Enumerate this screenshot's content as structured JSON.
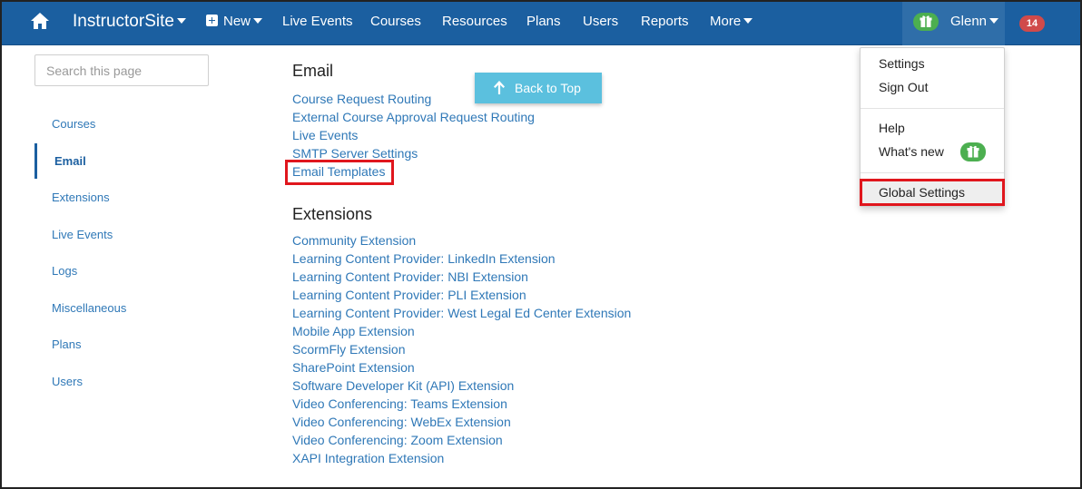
{
  "topnav": {
    "brand": "InstructorSite",
    "new_label": "New",
    "items": [
      "Live Events",
      "Courses",
      "Resources",
      "Plans",
      "Users",
      "Reports"
    ],
    "more_label": "More",
    "user_name": "Glenn",
    "notification_count": "14",
    "colors": {
      "bar": "#1b5fa0",
      "badge": "#d04a4a",
      "gift": "#4caf50"
    }
  },
  "sidebar": {
    "search_placeholder": "Search this page",
    "items": [
      {
        "label": "Courses"
      },
      {
        "label": "Email",
        "active": true
      },
      {
        "label": "Extensions"
      },
      {
        "label": "Live Events"
      },
      {
        "label": "Logs"
      },
      {
        "label": "Miscellaneous"
      },
      {
        "label": "Plans"
      },
      {
        "label": "Users"
      }
    ]
  },
  "main": {
    "back_to_top": "Back to Top",
    "email_section": {
      "heading": "Email",
      "links": [
        "Course Request Routing",
        "External Course Approval Request Routing",
        "Live Events",
        "SMTP Server Settings",
        "Email Templates"
      ],
      "highlighted": "Email Templates"
    },
    "extensions_section": {
      "heading": "Extensions",
      "links": [
        "Community Extension",
        "Learning Content Provider: LinkedIn Extension",
        "Learning Content Provider: NBI Extension",
        "Learning Content Provider: PLI Extension",
        "Learning Content Provider: West Legal Ed Center Extension",
        "Mobile App Extension",
        "ScormFly Extension",
        "SharePoint Extension",
        "Software Developer Kit (API) Extension",
        "Video Conferencing: Teams Extension",
        "Video Conferencing: WebEx Extension",
        "Video Conferencing: Zoom Extension",
        "XAPI Integration Extension"
      ]
    }
  },
  "user_menu": {
    "settings": "Settings",
    "sign_out": "Sign Out",
    "help": "Help",
    "whats_new": "What's new",
    "global_settings": "Global Settings",
    "highlighted": "Global Settings"
  }
}
